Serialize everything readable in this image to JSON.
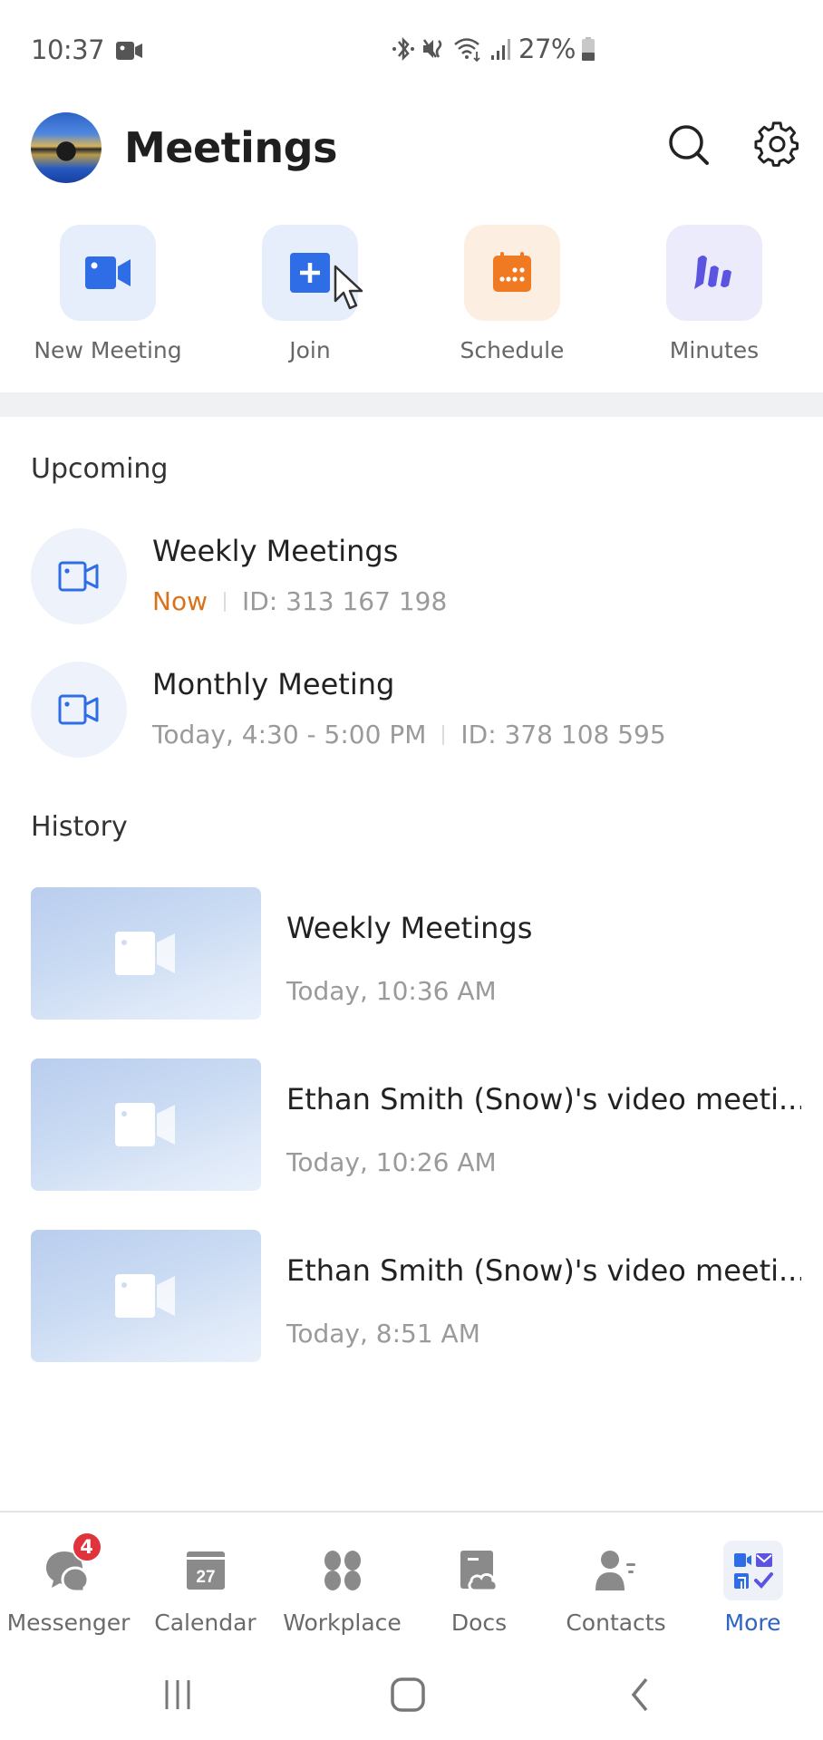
{
  "status_bar": {
    "time": "10:37",
    "battery_percent": "27%",
    "icons": [
      "screen-record-icon",
      "bluetooth-icon",
      "mute-icon",
      "wifi-icon",
      "signal-icon",
      "battery-icon"
    ]
  },
  "header": {
    "title": "Meetings",
    "search_icon": "search-icon",
    "settings_icon": "gear-icon"
  },
  "quick_actions": [
    {
      "label": "New Meeting",
      "icon": "video-camera-icon",
      "color": "#2e6de6",
      "bg": "#e6eefb"
    },
    {
      "label": "Join",
      "icon": "plus-square-icon",
      "color": "#2e6de6",
      "bg": "#e6eefb"
    },
    {
      "label": "Schedule",
      "icon": "calendar-icon",
      "color": "#f07a22",
      "bg": "#fdeee2"
    },
    {
      "label": "Minutes",
      "icon": "minutes-pen-icon",
      "color": "#5b54e0",
      "bg": "#ebebfb"
    }
  ],
  "upcoming": {
    "title": "Upcoming",
    "items": [
      {
        "title": "Weekly Meetings",
        "status": "Now",
        "meeting_id": "ID: 313 167 198"
      },
      {
        "title": "Monthly Meeting",
        "status": "Today, 4:30 - 5:00 PM",
        "meeting_id": "ID: 378 108 595"
      }
    ]
  },
  "history": {
    "title": "History",
    "items": [
      {
        "title": "Weekly Meetings",
        "time": "Today, 10:36 AM"
      },
      {
        "title": "Ethan Smith (Snow)'s video meeti...",
        "time": "Today, 10:26 AM"
      },
      {
        "title": "Ethan Smith (Snow)'s video meeti...",
        "time": "Today, 8:51 AM"
      }
    ]
  },
  "bottom_nav": {
    "active": "More",
    "tabs": [
      {
        "label": "Messenger",
        "icon": "messenger-icon",
        "badge": "4"
      },
      {
        "label": "Calendar",
        "icon": "calendar-icon",
        "calendar_day": "27"
      },
      {
        "label": "Workplace",
        "icon": "workplace-icon"
      },
      {
        "label": "Docs",
        "icon": "docs-icon"
      },
      {
        "label": "Contacts",
        "icon": "contacts-icon"
      },
      {
        "label": "More",
        "icon": "more-apps-icon"
      }
    ]
  },
  "colors": {
    "accent": "#2e63c7",
    "now_status": "#d9731b",
    "badge": "#e0333c"
  }
}
